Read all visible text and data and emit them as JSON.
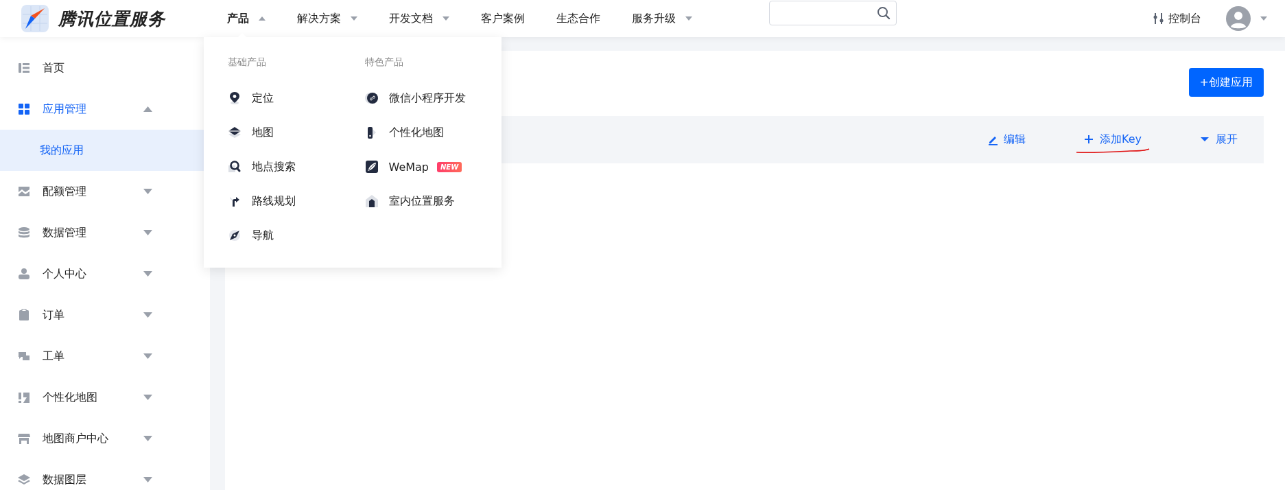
{
  "header": {
    "logo_text": "腾讯位置服务",
    "nav": [
      {
        "label": "产品",
        "kind": "menu",
        "selected": true,
        "expanded": true
      },
      {
        "label": "解决方案",
        "kind": "menu",
        "selected": false,
        "expanded": false
      },
      {
        "label": "开发文档",
        "kind": "menu",
        "selected": false,
        "expanded": false
      },
      {
        "label": "客户案例",
        "kind": "link",
        "selected": false
      },
      {
        "label": "生态合作",
        "kind": "link",
        "selected": false
      },
      {
        "label": "服务升级",
        "kind": "menu",
        "selected": false,
        "expanded": false
      }
    ],
    "console": "控制台"
  },
  "sidebar": {
    "items": [
      {
        "label": "首页",
        "kind": "link",
        "selected": false
      },
      {
        "label": "应用管理",
        "kind": "group",
        "selected": true,
        "expanded": true,
        "children": [
          {
            "label": "我的应用",
            "selected": true
          }
        ]
      },
      {
        "label": "配额管理",
        "kind": "group",
        "selected": false,
        "expanded": false
      },
      {
        "label": "数据管理",
        "kind": "group",
        "selected": false,
        "expanded": false
      },
      {
        "label": "个人中心",
        "kind": "group",
        "selected": false,
        "expanded": false
      },
      {
        "label": "订单",
        "kind": "group",
        "selected": false,
        "expanded": false
      },
      {
        "label": "工单",
        "kind": "group",
        "selected": false,
        "expanded": false
      },
      {
        "label": "个性化地图",
        "kind": "group",
        "selected": false,
        "expanded": false
      },
      {
        "label": "地图商户中心",
        "kind": "group",
        "selected": false,
        "expanded": false
      },
      {
        "label": "数据图层",
        "kind": "group",
        "selected": false,
        "expanded": false
      }
    ]
  },
  "products_menu": {
    "columns": [
      {
        "heading": "基础产品",
        "items": [
          {
            "label": "定位"
          },
          {
            "label": "地图"
          },
          {
            "label": "地点搜索"
          },
          {
            "label": "路线规划"
          },
          {
            "label": "导航"
          }
        ]
      },
      {
        "heading": "特色产品",
        "items": [
          {
            "label": "微信小程序开发"
          },
          {
            "label": "个性化地图"
          },
          {
            "label": "WeMap",
            "badge": "NEW"
          },
          {
            "label": "室内位置服务"
          }
        ]
      }
    ]
  },
  "main": {
    "create_button": "+创建应用",
    "app_actions": [
      {
        "label": "编辑",
        "annotated": false
      },
      {
        "label": "添加Key",
        "annotated": true
      },
      {
        "label": "展开",
        "annotated": false
      }
    ]
  }
}
